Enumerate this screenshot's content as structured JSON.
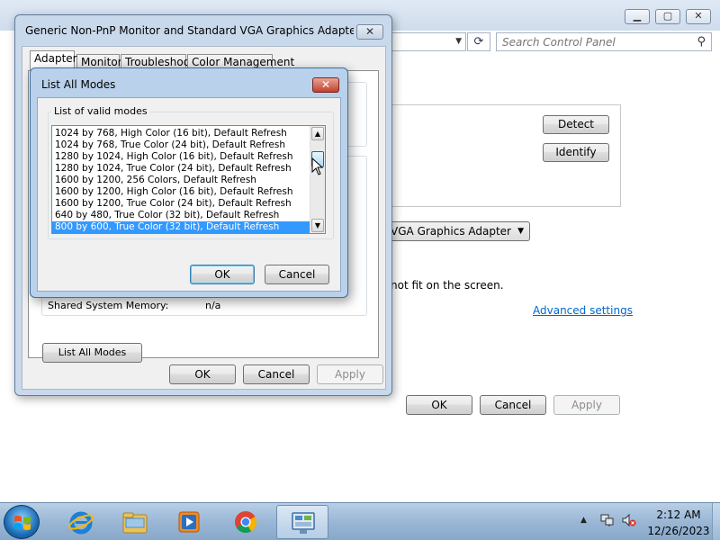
{
  "control_panel": {
    "search_placeholder": "Search Control Panel",
    "refresh_glyph": "⟳",
    "search_glyph": "⚲",
    "detect_label": "Detect",
    "identify_label": "Identify",
    "display_select_value": "rd VGA Graphics Adapter",
    "fit_text": "not fit on the screen.",
    "advanced_link": "Advanced settings",
    "ok_label": "OK",
    "cancel_label": "Cancel",
    "apply_label": "Apply"
  },
  "properties_dialog": {
    "title": "Generic Non-PnP Monitor and Standard VGA Graphics Adapter Pro...",
    "tabs": [
      {
        "label": "Adapter"
      },
      {
        "label": "Monitor"
      },
      {
        "label": "Troubleshoot"
      },
      {
        "label": "Color Management"
      }
    ],
    "shared_memory_label": "Shared System Memory:",
    "shared_memory_value": "n/a",
    "list_all_modes_button": "List All Modes",
    "ok_label": "OK",
    "cancel_label": "Cancel",
    "apply_label": "Apply"
  },
  "modes_dialog": {
    "title": "List All Modes",
    "group_label": "List of valid modes",
    "modes": [
      "1024 by 768, High Color (16 bit), Default Refresh",
      "1024 by 768, True Color (24 bit), Default Refresh",
      "1280 by 1024, High Color (16 bit), Default Refresh",
      "1280 by 1024, True Color (24 bit), Default Refresh",
      "1600 by 1200, 256 Colors, Default Refresh",
      "1600 by 1200, High Color (16 bit), Default Refresh",
      "1600 by 1200, True Color (24 bit), Default Refresh",
      "640 by 480, True Color (32 bit), Default Refresh",
      "800 by 600, True Color (32 bit), Default Refresh"
    ],
    "selected_index": 8,
    "ok_label": "OK",
    "cancel_label": "Cancel"
  },
  "taskbar": {
    "apps": [
      {
        "name": "internet-explorer-icon"
      },
      {
        "name": "windows-explorer-icon"
      },
      {
        "name": "media-player-icon"
      },
      {
        "name": "chrome-icon"
      },
      {
        "name": "control-panel-icon"
      }
    ],
    "active_app": "control-panel-icon",
    "clock_time": "2:12 AM",
    "clock_date": "12/26/2023"
  },
  "colors": {
    "selection": "#3399ff",
    "link": "#0066cc",
    "titlebar": "#c9d9ec",
    "close_red": "#c2412c"
  }
}
